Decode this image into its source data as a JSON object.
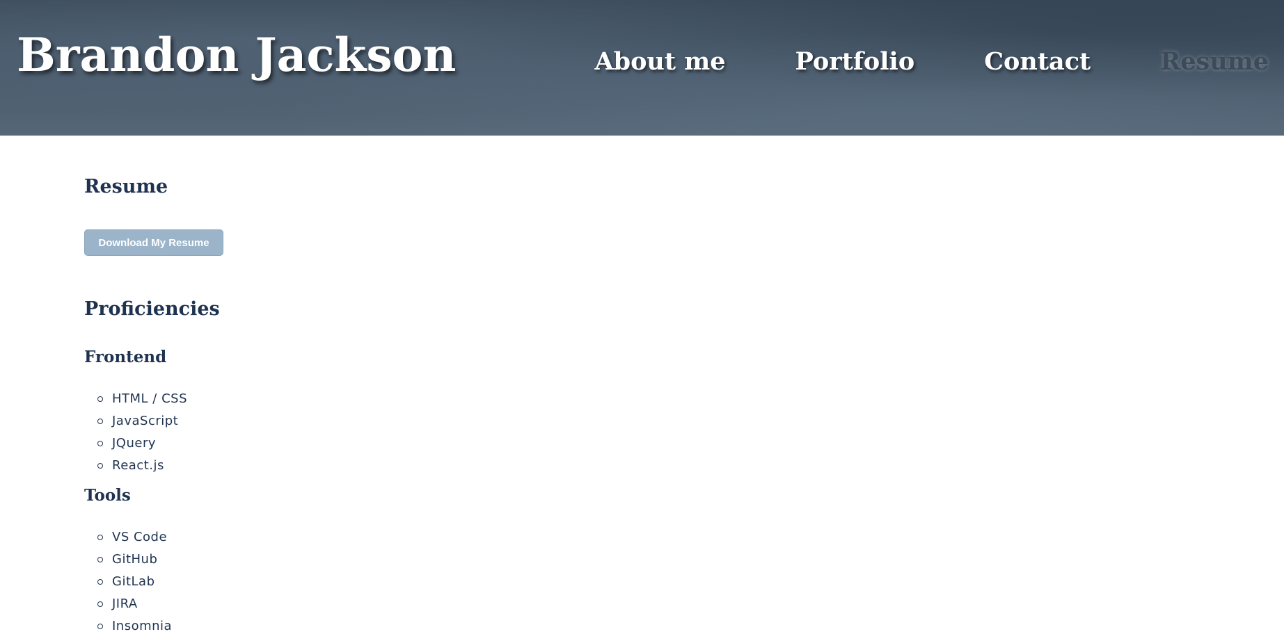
{
  "header": {
    "site_title": "Brandon Jackson",
    "nav": [
      {
        "label": "About me",
        "active": false
      },
      {
        "label": "Portfolio",
        "active": false
      },
      {
        "label": "Contact",
        "active": false
      },
      {
        "label": "Resume",
        "active": true
      }
    ]
  },
  "resume": {
    "title": "Resume",
    "download_label": "Download My Resume"
  },
  "proficiencies": {
    "title": "Proficiencies",
    "frontend": {
      "title": "Frontend",
      "items": [
        "HTML / CSS",
        "JavaScript",
        "JQuery",
        "React.js"
      ]
    },
    "tools": {
      "title": "Tools",
      "items": [
        "VS Code",
        "GitHub",
        "GitLab",
        "JIRA",
        "Insomnia"
      ]
    }
  },
  "colors": {
    "heading_text": "#1f3350",
    "button_bg": "#9bb4c9",
    "active_nav": "#3d4b58"
  }
}
